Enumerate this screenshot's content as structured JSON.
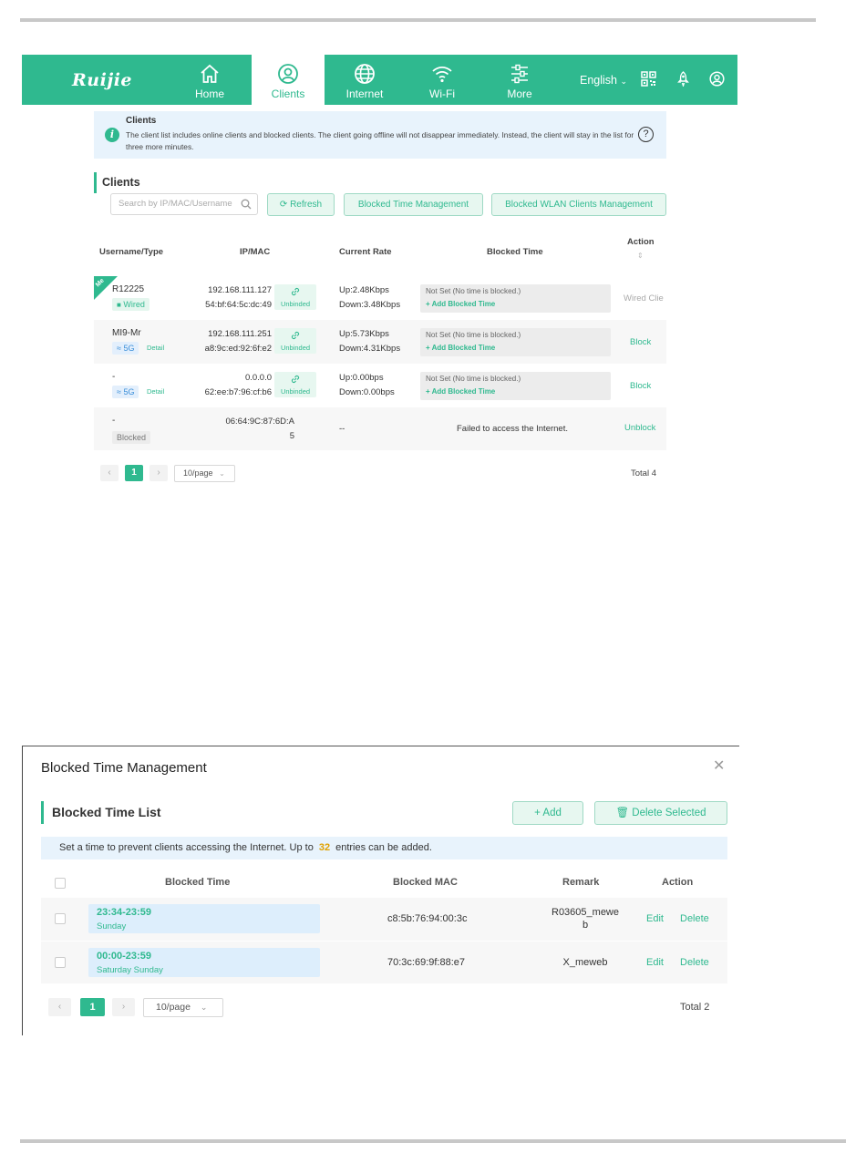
{
  "nav": {
    "logo": "Ruijie",
    "items": [
      {
        "label": "Home"
      },
      {
        "label": "Clients"
      },
      {
        "label": "Internet"
      },
      {
        "label": "Wi-Fi"
      },
      {
        "label": "More"
      }
    ],
    "language": "English",
    "active_tab": "Clients",
    "accent_color": "#2fb98f"
  },
  "notice": {
    "title": "Clients",
    "text": "The client list includes online clients and blocked clients. The client going offline will not disappear immediately. Instead, the client will stay in the list for three more minutes."
  },
  "clients": {
    "title": "Clients",
    "search_placeholder": "Search by IP/MAC/Username",
    "refresh_label": "Refresh",
    "blocked_time_btn": "Blocked Time Management",
    "blocked_wlan_btn": "Blocked WLAN Clients Management",
    "headers": {
      "username": "Username/Type",
      "ipmac": "IP/MAC",
      "rate": "Current Rate",
      "blocked_time": "Blocked Time",
      "action": "Action"
    },
    "rows": [
      {
        "me": "Me",
        "name": "R12225",
        "type": "Wired",
        "ip": "192.168.111.127",
        "mac": "54:bf:64:5c:dc:49",
        "bind": "Unbinded",
        "up": "Up:2.48Kbps",
        "down": "Down:3.48Kbps",
        "bt_status": "Not Set (No time is blocked.)",
        "bt_add": "Add Blocked Time",
        "action": "Wired Clie"
      },
      {
        "name": "MI9-Mr",
        "type": "5G",
        "detail": "Detail",
        "ip": "192.168.111.251",
        "mac": "a8:9c:ed:92:6f:e2",
        "bind": "Unbinded",
        "up": "Up:5.73Kbps",
        "down": "Down:4.31Kbps",
        "bt_status": "Not Set (No time is blocked.)",
        "bt_add": "Add Blocked Time",
        "action": "Block"
      },
      {
        "name": "-",
        "type": "5G",
        "detail": "Detail",
        "ip": "0.0.0.0",
        "mac": "62:ee:b7:96:cf:b6",
        "bind": "Unbinded",
        "up": "Up:0.00bps",
        "down": "Down:0.00bps",
        "bt_status": "Not Set (No time is blocked.)",
        "bt_add": "Add Blocked Time",
        "action": "Block"
      },
      {
        "name": "-",
        "type": "Blocked",
        "mac_line1": "06:64:9C:87:6D:A",
        "mac_line2": "5",
        "rate": "--",
        "bt_status": "Failed to access the Internet.",
        "action": "Unblock"
      }
    ],
    "pager": {
      "current": "1",
      "page_size": "10/page",
      "total": "Total 4"
    }
  },
  "modal": {
    "title": "Blocked Time Management",
    "list_title": "Blocked Time List",
    "add_label": "Add",
    "delete_selected_label": "Delete Selected",
    "notice_before": "Set a time to prevent clients accessing the Internet. Up to",
    "notice_count": "32",
    "notice_after": "entries can be added.",
    "headers": {
      "time": "Blocked Time",
      "mac": "Blocked MAC",
      "remark": "Remark",
      "action": "Action"
    },
    "rows": [
      {
        "time": "23:34-23:59",
        "days": "Sunday",
        "mac": "c8:5b:76:94:00:3c",
        "remark_l1": "R03605_mewe",
        "remark_l2": "b",
        "edit": "Edit",
        "delete": "Delete"
      },
      {
        "time": "00:00-23:59",
        "days": "Saturday Sunday",
        "mac": "70:3c:69:9f:88:e7",
        "remark_l1": "X_meweb",
        "remark_l2": "",
        "edit": "Edit",
        "delete": "Delete"
      }
    ],
    "pager": {
      "current": "1",
      "page_size": "10/page",
      "total": "Total 2"
    }
  }
}
